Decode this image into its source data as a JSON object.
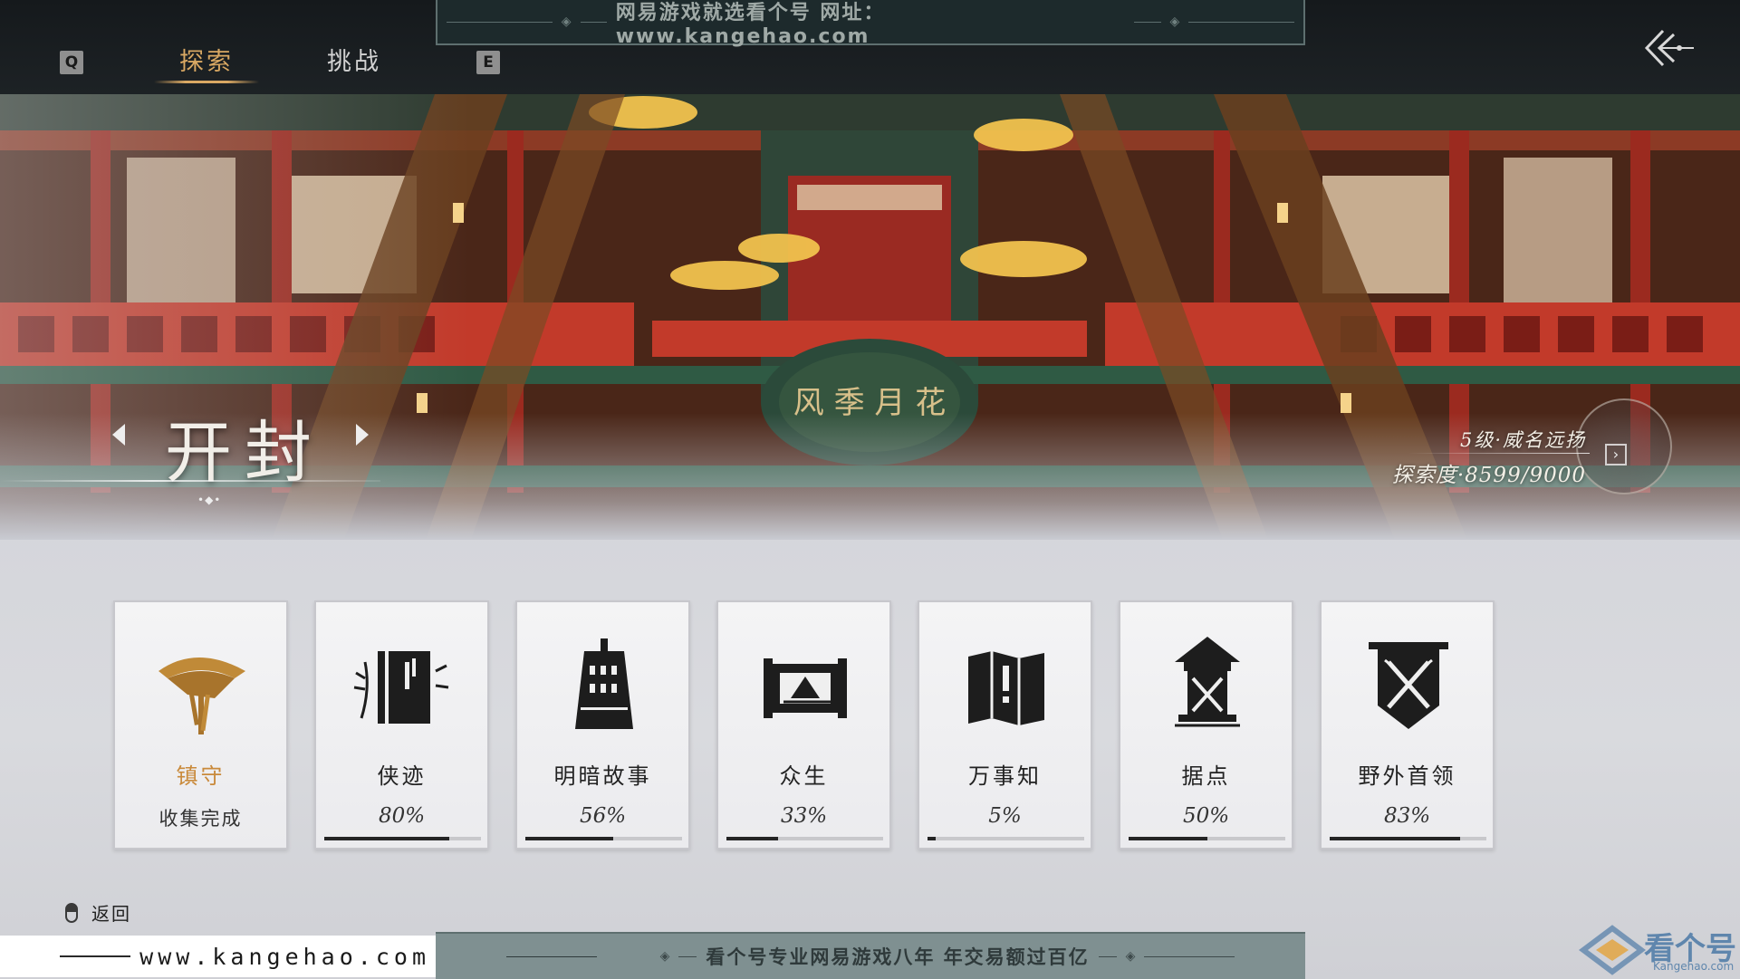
{
  "watermark": {
    "top_text": "网易游戏就选看个号   网址：www.kangehao.com",
    "bottom_text": "看个号专业网易游戏八年   年交易额过百亿",
    "site_text": "www.kangehao.com",
    "logo_text": "看个号",
    "logo_sub": "Kangehao.com"
  },
  "topbar": {
    "key_left": "Q",
    "key_right": "E",
    "tabs": [
      {
        "label": "探索",
        "active": true
      },
      {
        "label": "挑战",
        "active": false
      }
    ]
  },
  "region": {
    "name": "开封",
    "dots": "•◆•",
    "rank": "5级·威名远扬",
    "progress": "探索度·8599/9000",
    "progress_value": 8599,
    "progress_max": 9000
  },
  "cards": [
    {
      "title": "镇守",
      "status": "收集完成",
      "progress": 1.0,
      "complete": true,
      "icon": "bamboo-hat-icon"
    },
    {
      "title": "侠迹",
      "status": "80%",
      "progress": 0.8,
      "complete": false,
      "icon": "book-icon"
    },
    {
      "title": "明暗故事",
      "status": "56%",
      "progress": 0.56,
      "complete": false,
      "icon": "bell-icon"
    },
    {
      "title": "众生",
      "status": "33%",
      "progress": 0.33,
      "complete": false,
      "icon": "scroll-painting-icon"
    },
    {
      "title": "万事知",
      "status": "5%",
      "progress": 0.05,
      "complete": false,
      "icon": "map-icon"
    },
    {
      "title": "据点",
      "status": "50%",
      "progress": 0.5,
      "complete": false,
      "icon": "watchtower-icon"
    },
    {
      "title": "野外首领",
      "status": "83%",
      "progress": 0.83,
      "complete": false,
      "icon": "crossed-swords-banner-icon"
    }
  ],
  "footer": {
    "return_label": "返回",
    "return_icon": "mouse-icon"
  },
  "colors": {
    "accent_gold": "#d9a863",
    "complete_orange": "#c98a3b",
    "bar_fill": "#242424"
  }
}
